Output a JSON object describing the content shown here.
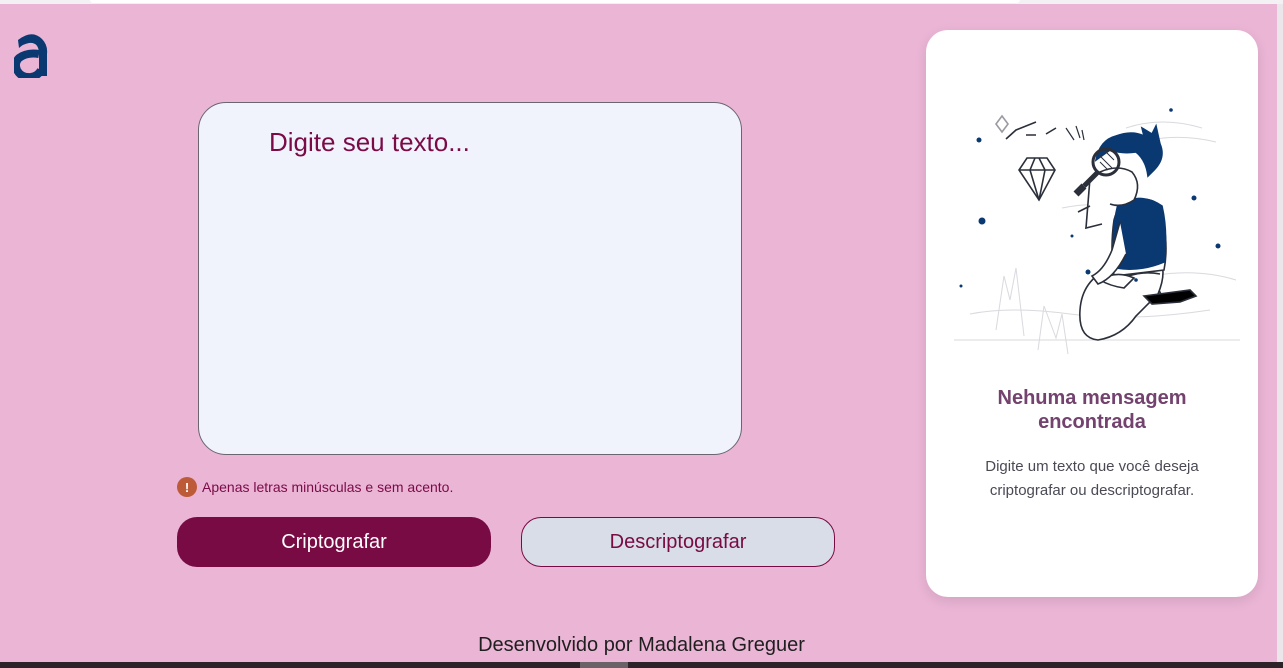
{
  "logo": {
    "icon": "alura-a-logo",
    "color": "#0a3871"
  },
  "input": {
    "placeholder": "Digite seu texto...",
    "value": ""
  },
  "hint": {
    "icon": "exclamation-icon",
    "icon_glyph": "!",
    "text": "Apenas letras minúsculas e sem acento."
  },
  "actions": {
    "encrypt_label": "Criptografar",
    "decrypt_label": "Descriptografar"
  },
  "output": {
    "illustration": "boy-with-magnifying-glass-and-diamond",
    "title": "Nehuma mensagem encontrada",
    "description": "Digite um texto que você deseja criptografar ou descriptografar."
  },
  "footer": {
    "text": "Desenvolvido por Madalena Greguer"
  },
  "colors": {
    "background": "#ebb5d6",
    "accent": "#780a44",
    "secondary_button": "#d8dde7",
    "text_area": "#f1f3fc",
    "title": "#73426e",
    "brand_blue": "#0a3871",
    "warning": "#bd5a37"
  }
}
